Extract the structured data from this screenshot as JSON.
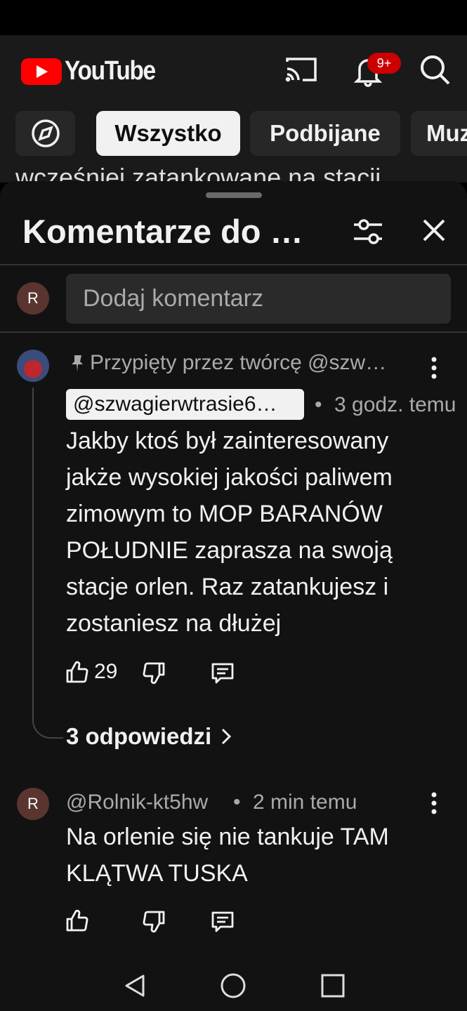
{
  "app": {
    "name": "YouTube"
  },
  "header": {
    "logo_text": "YouTube",
    "icons": [
      "cast-icon",
      "bell-icon",
      "search-icon"
    ],
    "notification_badge": "9+"
  },
  "chips": {
    "items": [
      "Wszystko",
      "Podbijane",
      "Muz"
    ],
    "active": "Wszystko"
  },
  "peek_text": "wcześniej zatankowane na stacji",
  "sheet": {
    "title": "Komentarze do …",
    "add_comment_placeholder": "Dodaj komentarz",
    "user_avatar_letter": "R"
  },
  "comments": [
    {
      "pinned_label": "Przypięty przez twórcę @szw…",
      "author": "@szwagierwtrasie6…",
      "time": "3 godz. temu",
      "text": "Jakby ktoś był zainteresowany jakże wysokiej jakości paliwem zimowym to MOP BARANÓW POŁUDNIE zaprasza na swoją stacje orlen. Raz zatankujesz i zostaniesz na dłużej",
      "likes": "29",
      "replies_label": "3 odpowiedzi"
    },
    {
      "avatar_letter": "R",
      "author": "@Rolnik-kt5hw",
      "time": "2 min temu",
      "text": "Na orlenie się nie tankuje TAM KLĄTWA TUSKA"
    }
  ],
  "separator": "•",
  "colors": {
    "accent": "#ff0000",
    "badge": "#cc0000",
    "background": "#121212"
  }
}
